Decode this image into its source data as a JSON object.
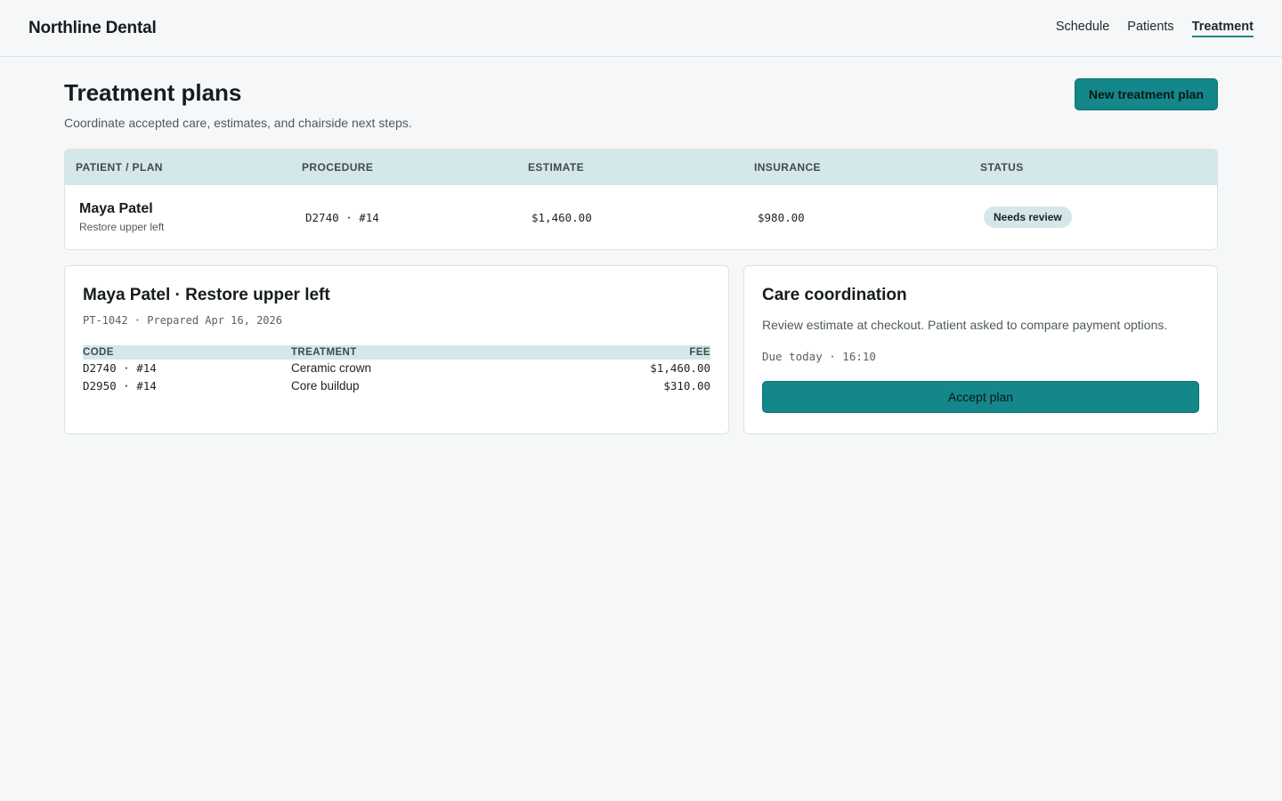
{
  "app": {
    "brand": "Northline Dental"
  },
  "nav": {
    "items": [
      {
        "label": "Schedule",
        "active": false
      },
      {
        "label": "Patients",
        "active": false
      },
      {
        "label": "Treatment",
        "active": true
      }
    ]
  },
  "page": {
    "title": "Treatment plans",
    "subtitle": "Coordinate accepted care, estimates, and chairside next steps.",
    "new_button": "New treatment plan"
  },
  "plans_table": {
    "headers": [
      "PATIENT / PLAN",
      "PROCEDURE",
      "ESTIMATE",
      "INSURANCE",
      "STATUS"
    ],
    "rows": [
      {
        "patient": "Maya Patel",
        "plan": "Restore upper left",
        "procedure": "D2740 · #14",
        "estimate": "$1,460.00",
        "insurance": "$980.00",
        "status": "Needs review"
      }
    ]
  },
  "plan_detail": {
    "title": "Maya Patel · Restore upper left",
    "meta": "PT-1042 · Prepared Apr 16, 2026",
    "headers": {
      "code": "CODE",
      "treatment": "TREATMENT",
      "fee": "FEE"
    },
    "lines": [
      {
        "code": "D2740 · #14",
        "treatment": "Ceramic crown",
        "fee": "$1,460.00"
      },
      {
        "code": "D2950 · #14",
        "treatment": "Core buildup",
        "fee": "$310.00"
      }
    ]
  },
  "coordination": {
    "title": "Care coordination",
    "text": "Review estimate at checkout. Patient asked to compare payment options.",
    "due": "Due today · 16:10",
    "accept_button": "Accept plan"
  },
  "colors": {
    "accent": "#13878a",
    "header_tint": "#d4e7e9",
    "background": "#f5f7f8"
  }
}
